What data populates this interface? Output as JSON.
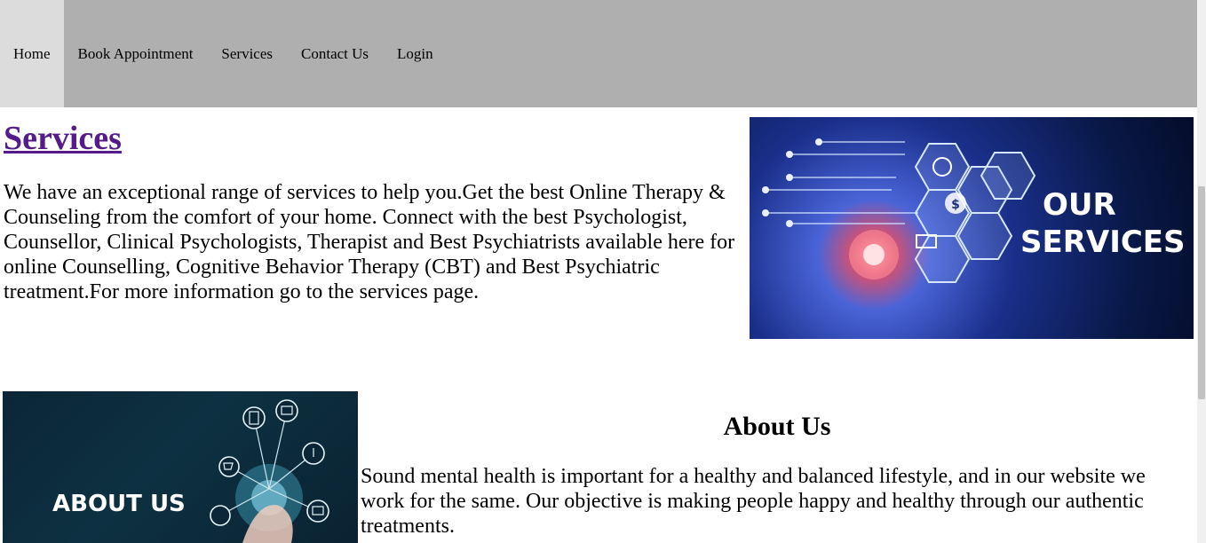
{
  "nav": {
    "items": [
      {
        "label": "Home"
      },
      {
        "label": "Book Appointment"
      },
      {
        "label": "Services"
      },
      {
        "label": "Contact Us"
      },
      {
        "label": "Login"
      }
    ]
  },
  "services": {
    "title": "Services",
    "text": "We have an exceptional range of services to help you.Get the best Online Therapy & Counseling from the comfort of your home. Connect with the best Psychologist, Counsellor, Clinical Psychologists, Therapist and Best Psychiatrists available here for online Counselling, Cognitive Behavior Therapy (CBT) and Best Psychiatric treatment.For more information go to the services page.",
    "image_caption_line1": "OUR",
    "image_caption_line2": "SERVICES"
  },
  "about": {
    "title": "About Us",
    "text": "Sound mental health is important for a healthy and balanced lifestyle, and in our website we work for the same. Our objective is making people happy and healthy through our authentic treatments.",
    "image_caption": "ABOUT US"
  },
  "colors": {
    "navbar_bg": "#afafaf",
    "nav_active_bg": "#dcdcdc",
    "link_visited": "#551a8b"
  },
  "icons": {
    "services_image": "our-services-hexagon-graphic",
    "about_image": "about-us-network-icons-graphic",
    "dollar": "dollar-icon",
    "cart": "cart-icon",
    "document": "document-icon",
    "mail": "mail-icon"
  }
}
